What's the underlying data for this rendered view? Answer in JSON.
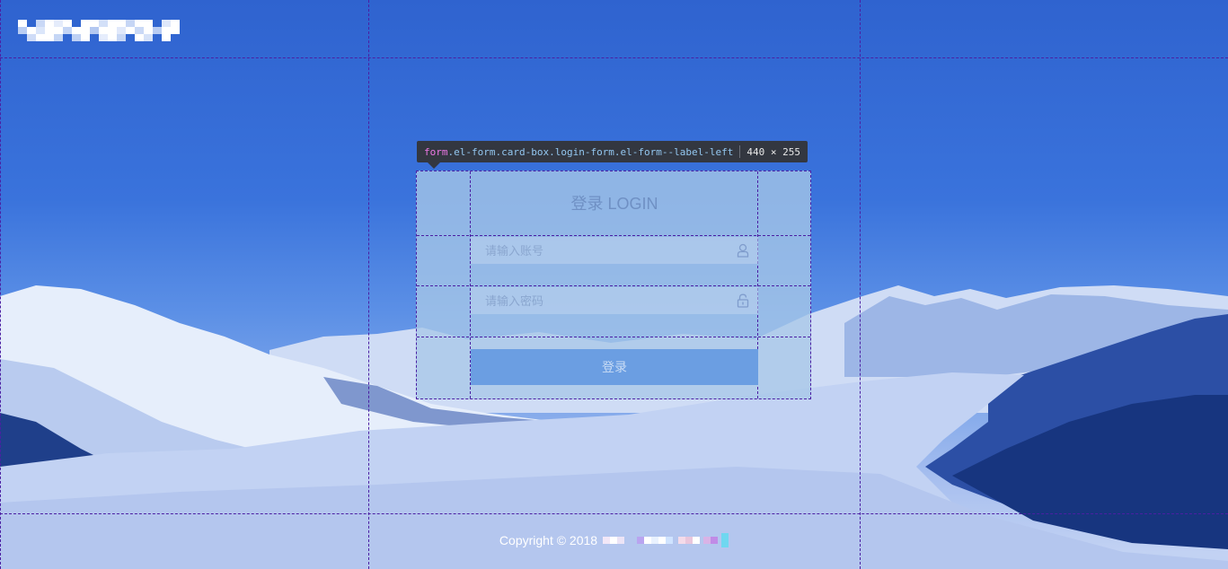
{
  "form": {
    "title": "登录 LOGIN",
    "username_placeholder": "请输入账号",
    "password_placeholder": "请输入密码",
    "username_value": "",
    "password_value": "",
    "submit_label": "登录",
    "username_icon": "user-icon",
    "password_icon": "lock-icon"
  },
  "devtools_tooltip": {
    "tag": "form",
    "classes": ".el-form.card-box.login-form.el-form--label-left",
    "size": "440 × 255"
  },
  "footer": {
    "copyright": "Copyright © 2018"
  },
  "colors": {
    "card_bg": "#a8c8e8",
    "button_bg": "#6b9ee2",
    "guide_line": "#4b1fa3",
    "sky": "#2f63cf"
  }
}
